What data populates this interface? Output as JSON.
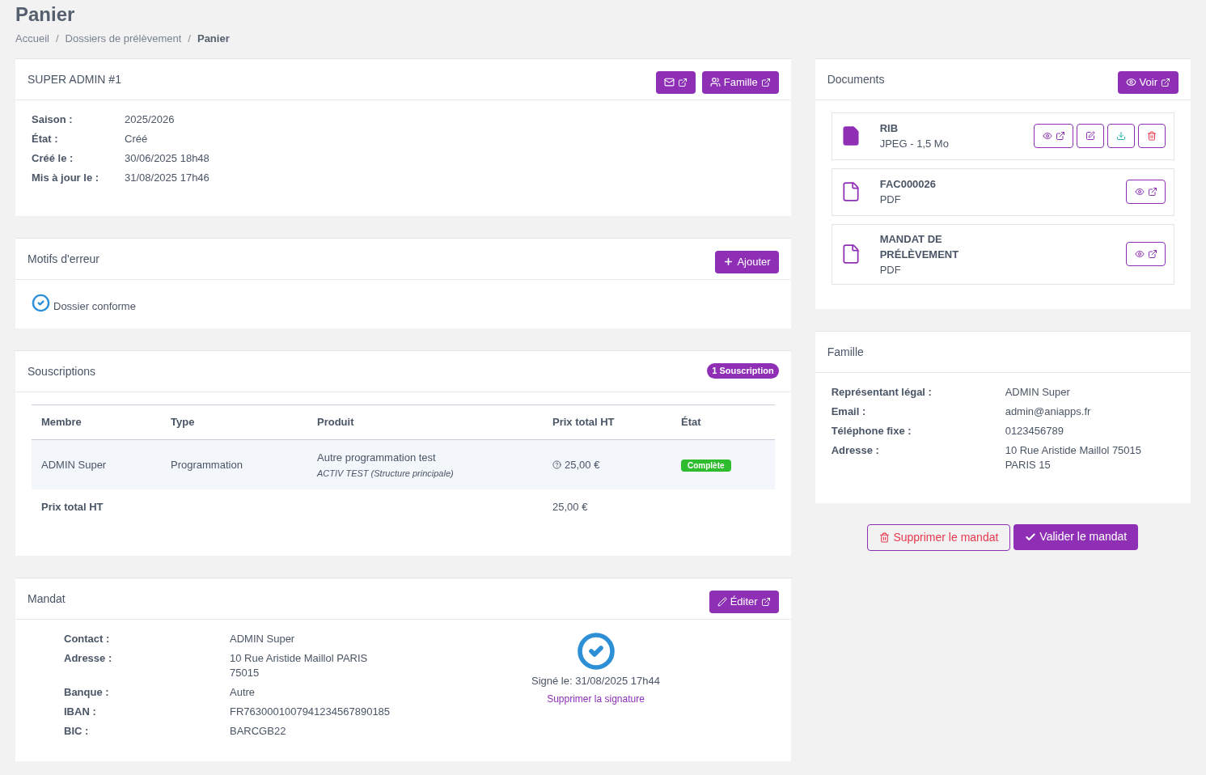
{
  "page": {
    "title": "Panier",
    "separator": "/",
    "breadcrumb": [
      {
        "label": "Accueil",
        "current": false
      },
      {
        "label": "Dossiers de prélèvement",
        "current": false
      },
      {
        "label": "Panier",
        "current": true
      }
    ]
  },
  "dossier": {
    "title": "SUPER ADMIN #1",
    "family_button": "Famille",
    "fields": [
      {
        "label": "Saison :",
        "value": "2025/2026"
      },
      {
        "label": "État :",
        "value": "Créé"
      },
      {
        "label": "Créé le :",
        "value": "30/06/2025 18h48"
      },
      {
        "label": "Mis à jour le :",
        "value": "31/08/2025 17h46"
      }
    ]
  },
  "errors": {
    "title": "Motifs d'erreur",
    "add_button": "Ajouter",
    "status": "Dossier conforme",
    "conforme": true
  },
  "subscriptions": {
    "title": "Souscriptions",
    "count_badge": "1 Souscription",
    "columns": [
      "Membre",
      "Type",
      "Produit",
      "Prix total HT",
      "État"
    ],
    "rows": [
      {
        "member": "ADMIN Super",
        "type": "Programmation",
        "product": "Autre programmation test",
        "structure": "ACTIV TEST (Structure principale)",
        "price": "25,00 €",
        "state": "Complète",
        "color": "#2fbd2f"
      }
    ],
    "total_label": "Prix total HT",
    "total": "25,00 €"
  },
  "mandate": {
    "title": "Mandat",
    "edit_button": "Éditer",
    "fields": [
      {
        "label": "Contact :",
        "value": "ADMIN Super"
      },
      {
        "label": "Adresse :",
        "value": "10 Rue Aristide Maillol PARIS 75015"
      },
      {
        "label": "Banque :",
        "value": "Autre"
      },
      {
        "label": "IBAN :",
        "value": "FR7630001007941234567890185"
      },
      {
        "label": "BIC :",
        "value": "BARCGB22"
      }
    ],
    "signed": true,
    "signed_text": "Signé le: 31/08/2025 17h44",
    "remove_signature": "Supprimer la signature"
  },
  "documents": {
    "title": "Documents",
    "view_button": "Voir",
    "items": [
      {
        "name": "RIB",
        "meta": "JPEG - 1,5 Mo",
        "kind": "uploaded",
        "actions": [
          {
            "kind": "view"
          },
          {
            "kind": "edit"
          },
          {
            "kind": "download"
          },
          {
            "kind": "delete"
          }
        ]
      },
      {
        "name": "FAC000026",
        "meta": "PDF",
        "kind": "generated",
        "actions": [
          {
            "kind": "view"
          }
        ]
      },
      {
        "name": "MANDAT DE PRÉLÈVEMENT",
        "meta": "PDF",
        "kind": "generated",
        "actions": [
          {
            "kind": "view"
          }
        ]
      }
    ]
  },
  "family": {
    "title": "Famille",
    "fields": [
      {
        "label": "Représentant légal :",
        "value": "ADMIN Super"
      },
      {
        "label": "Email :",
        "value": "admin@aniapps.fr"
      },
      {
        "label": "Téléphone fixe :",
        "value": "0123456789"
      },
      {
        "label": "Adresse :",
        "value": "10 Rue Aristide Maillol 75015 PARIS 15"
      }
    ]
  },
  "actions": {
    "delete": "Supprimer le mandat",
    "validate": "Valider le mandat"
  }
}
